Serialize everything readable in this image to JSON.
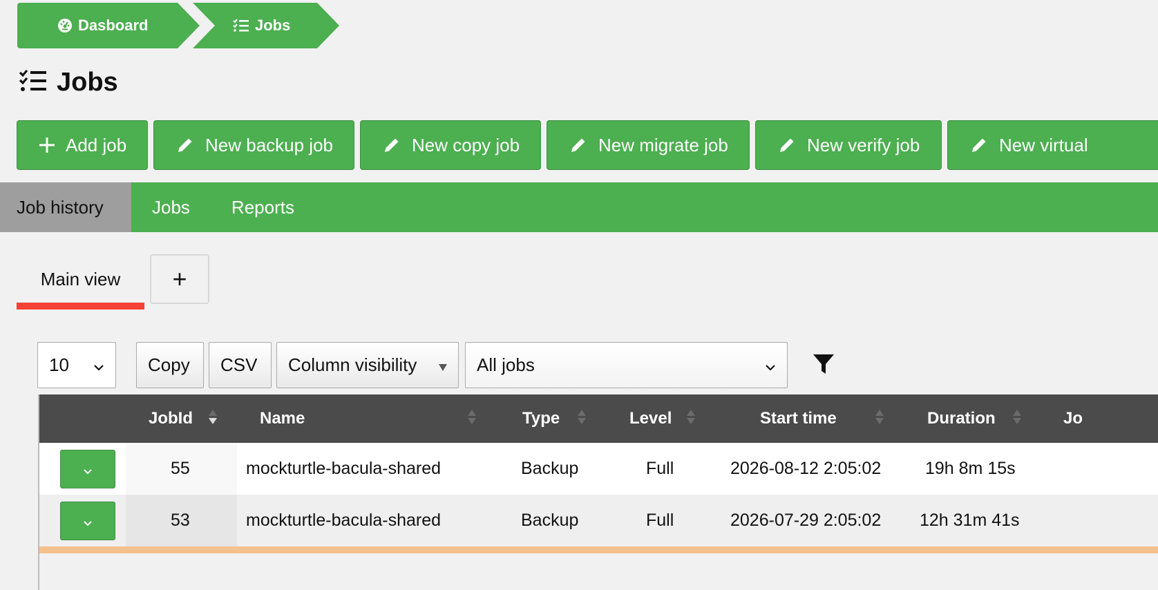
{
  "breadcrumbs": [
    {
      "label": "Dasboard",
      "icon": "dashboard-icon"
    },
    {
      "label": "Jobs",
      "icon": "tasks-list-icon"
    }
  ],
  "page": {
    "title": "Jobs",
    "icon": "tasks-list-icon"
  },
  "actions": [
    {
      "label": "Add job",
      "icon": "plus-icon"
    },
    {
      "label": "New backup job",
      "icon": "pencil-icon"
    },
    {
      "label": "New copy job",
      "icon": "pencil-icon"
    },
    {
      "label": "New migrate job",
      "icon": "pencil-icon"
    },
    {
      "label": "New verify job",
      "icon": "pencil-icon"
    },
    {
      "label": "New virtual",
      "icon": "pencil-icon"
    }
  ],
  "nav": [
    {
      "label": "Job history",
      "active": true
    },
    {
      "label": "Jobs",
      "active": false
    },
    {
      "label": "Reports",
      "active": false
    }
  ],
  "views": {
    "active": "Main view",
    "add_label": "+"
  },
  "toolbar": {
    "page_length": "10",
    "copy_label": "Copy",
    "csv_label": "CSV",
    "colvis_label": "Column visibility",
    "job_filter": "All jobs"
  },
  "table": {
    "columns": [
      "JobId",
      "Name",
      "Type",
      "Level",
      "Start time",
      "Duration",
      "Jo"
    ],
    "sorted_column": "JobId",
    "sort_direction": "desc",
    "rows": [
      {
        "jobid": "55",
        "name": "mockturtle-bacula-shared",
        "type": "Backup",
        "level": "Full",
        "start": "2026-08-12 2:05:02",
        "duration": "19h 8m 15s"
      },
      {
        "jobid": "53",
        "name": "mockturtle-bacula-shared",
        "type": "Backup",
        "level": "Full",
        "start": "2026-07-29 2:05:02",
        "duration": "12h 31m 41s"
      }
    ]
  },
  "colors": {
    "accent": "#4caf50",
    "active_tab_underline": "#f44336",
    "header_bg": "#4b4b4b",
    "nav_active_bg": "#9e9e9e",
    "warning_row": "#f4c08e"
  }
}
